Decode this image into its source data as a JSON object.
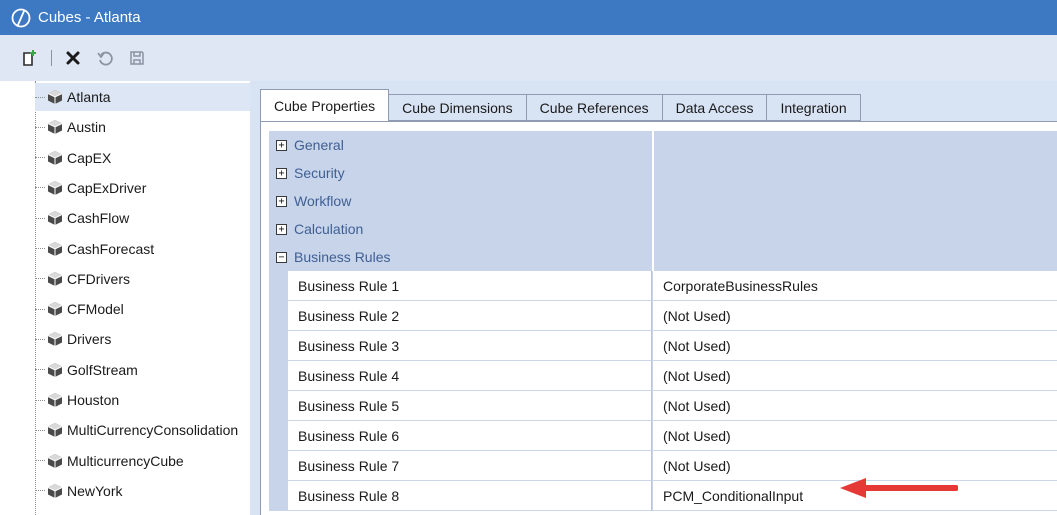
{
  "window": {
    "title": "Cubes - Atlanta"
  },
  "toolbar": {
    "buttons": [
      {
        "name": "new-icon"
      },
      {
        "name": "delete-icon"
      },
      {
        "name": "revert-icon"
      },
      {
        "name": "save-icon"
      }
    ]
  },
  "tree": {
    "items": [
      {
        "label": "Atlanta",
        "selected": true
      },
      {
        "label": "Austin"
      },
      {
        "label": "CapEX"
      },
      {
        "label": "CapExDriver"
      },
      {
        "label": "CashFlow"
      },
      {
        "label": "CashForecast"
      },
      {
        "label": "CFDrivers"
      },
      {
        "label": "CFModel"
      },
      {
        "label": "Drivers"
      },
      {
        "label": "GolfStream"
      },
      {
        "label": "Houston"
      },
      {
        "label": "MultiCurrencyConsolidation"
      },
      {
        "label": "MulticurrencyCube"
      },
      {
        "label": "NewYork"
      }
    ]
  },
  "tabs": [
    {
      "label": "Cube Properties",
      "active": true
    },
    {
      "label": "Cube Dimensions"
    },
    {
      "label": "Cube References"
    },
    {
      "label": "Data Access"
    },
    {
      "label": "Integration"
    }
  ],
  "categories": [
    {
      "label": "General",
      "expander": "+"
    },
    {
      "label": "Security",
      "expander": "+"
    },
    {
      "label": "Workflow",
      "expander": "+"
    },
    {
      "label": "Calculation",
      "expander": "+"
    },
    {
      "label": "Business Rules",
      "expander": "−"
    }
  ],
  "business_rules": [
    {
      "name": "Business Rule 1",
      "value": "CorporateBusinessRules"
    },
    {
      "name": "Business Rule 2",
      "value": "(Not Used)"
    },
    {
      "name": "Business Rule 3",
      "value": "(Not Used)"
    },
    {
      "name": "Business Rule 4",
      "value": "(Not Used)"
    },
    {
      "name": "Business Rule 5",
      "value": "(Not Used)"
    },
    {
      "name": "Business Rule 6",
      "value": "(Not Used)"
    },
    {
      "name": "Business Rule 7",
      "value": "(Not Used)"
    },
    {
      "name": "Business Rule 8",
      "value": "PCM_ConditionalInput"
    }
  ],
  "colors": {
    "titlebar": "#3c79c2",
    "toolbar": "#dfe7f4",
    "category_band": "#c7d4ea",
    "arrow": "#e53935"
  }
}
